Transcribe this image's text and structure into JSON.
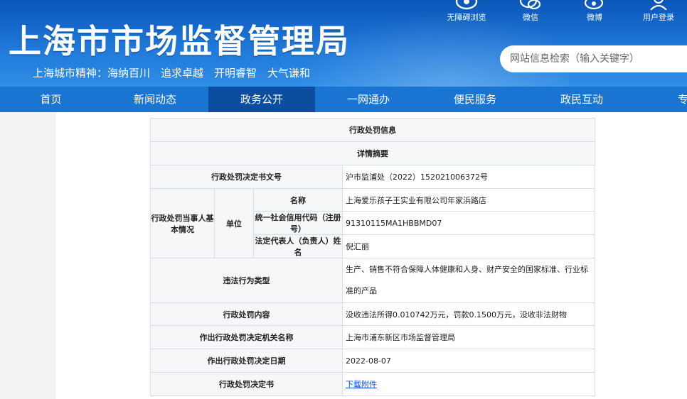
{
  "header": {
    "site_title": "上海市市场监督管理局",
    "spirit": "上海城市精神：海纳百川　追求卓越　开明睿智　大气谦和",
    "top_links": [
      {
        "label": "无障碍浏览",
        "icon": "accessibility-icon"
      },
      {
        "label": "微信",
        "icon": "wechat-icon"
      },
      {
        "label": "微博",
        "icon": "weibo-icon"
      },
      {
        "label": "用户登录",
        "icon": "user-icon"
      }
    ],
    "search_placeholder": "网站信息检索（输入关键字）"
  },
  "nav": [
    "首页",
    "新闻动态",
    "政务公开",
    "一网通办",
    "便民服务",
    "政民互动",
    "专题"
  ],
  "nav_active": "政务公开",
  "table": {
    "title": "行政处罚信息",
    "summary": "详情摘要",
    "doc_no_label": "行政处罚决定书文号",
    "doc_no": "沪市监浦处（2022）152021006372号",
    "party_label": "行政处罚当事人基本情况",
    "unit_label": "单位",
    "name_label": "名称",
    "name": "上海爱乐孩子王实业有限公司年家浜路店",
    "credit_label": "统一社会信用代码（注册号）",
    "credit": "91310115MA1HBBMD07",
    "rep_label": "法定代表人（负责人）姓名",
    "rep": "倪汇丽",
    "violation_label": "违法行为类型",
    "violation": "生产、销售不符合保障人体健康和人身、财产安全的国家标准、行业标准的产品",
    "penalty_label": "行政处罚内容",
    "penalty": "没收违法所得0.010742万元，罚款0.1500万元，没收非法财物",
    "org_label": "作出行政处罚决定机关名称",
    "org": "上海市浦东新区市场监督管理局",
    "date_label": "作出行政处罚决定日期",
    "date": "2022-08-07",
    "decision_label": "行政处罚决定书",
    "decision_link": "下载附件"
  }
}
